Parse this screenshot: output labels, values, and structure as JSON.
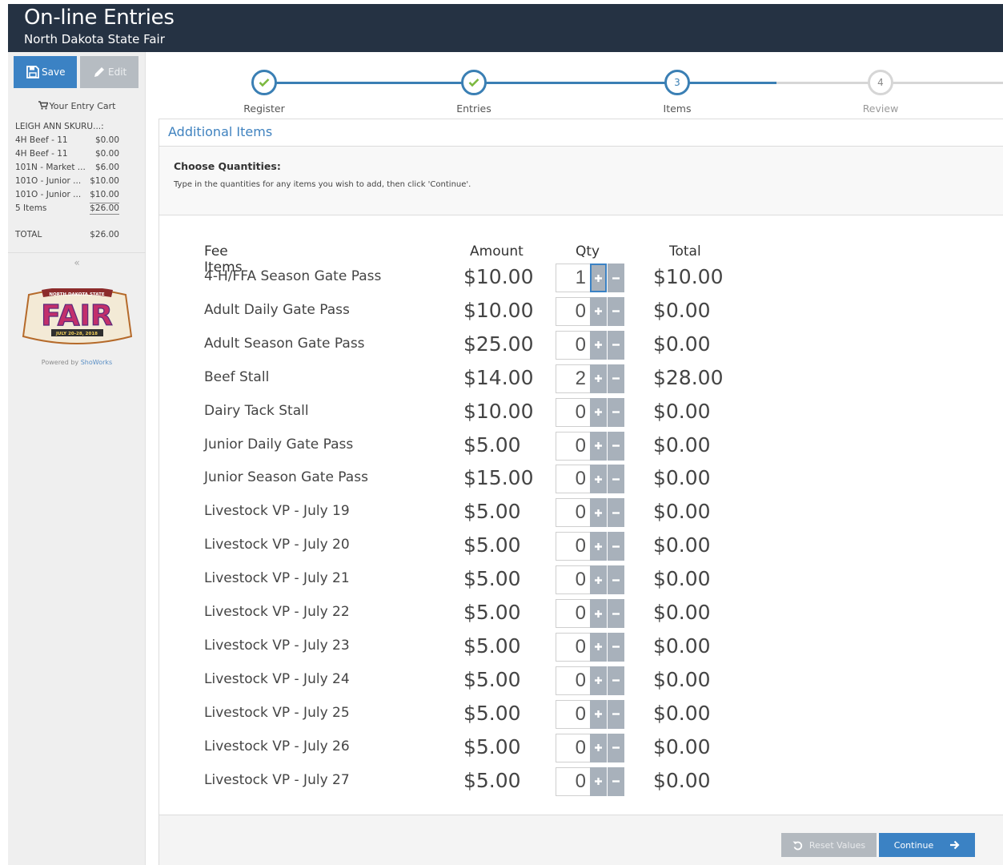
{
  "header": {
    "title": "On-line Entries",
    "subtitle": "North Dakota State Fair"
  },
  "sidebar": {
    "save_label": "Save",
    "edit_label": "Edit",
    "cart_title": "Your Entry Cart",
    "cart_owner": "LEIGH ANN SKURU...:",
    "cart_items": [
      {
        "name": "4H Beef - 11",
        "amount": "$0.00"
      },
      {
        "name": "4H Beef - 11",
        "amount": "$0.00"
      },
      {
        "name": "101N - Market ...",
        "amount": "$6.00"
      },
      {
        "name": "101O - Junior ...",
        "amount": "$10.00"
      },
      {
        "name": "101O - Junior ...",
        "amount": "$10.00"
      }
    ],
    "items_count": "5 Items",
    "items_subtotal": "$26.00",
    "total_label": "TOTAL",
    "total_value": "$26.00",
    "collapse_glyph": "«",
    "logo": {
      "top_text": "NORTH DAKOTA STATE",
      "main_text": "FAIR",
      "date_text": "JULY 20-28, 2018"
    },
    "powered_prefix": "Powered by",
    "powered_link": "ShoWorks"
  },
  "stepper": {
    "steps": [
      {
        "label": "Register",
        "state": "done",
        "number": ""
      },
      {
        "label": "Entries",
        "state": "done",
        "number": ""
      },
      {
        "label": "Items",
        "state": "current",
        "number": "3"
      },
      {
        "label": "Review",
        "state": "todo",
        "number": "4"
      }
    ]
  },
  "panel": {
    "title": "Additional Items",
    "instructions_heading": "Choose Quantities:",
    "instructions_text": "Type in the quantities for any items you wish to add, then click 'Continue'."
  },
  "table": {
    "headers": {
      "fee_items": "Fee Items",
      "amount": "Amount",
      "qty": "Qty",
      "total": "Total"
    },
    "rows": [
      {
        "name": "4-H/FFA Season Gate Pass",
        "amount": "$10.00",
        "qty": "1",
        "total": "$10.00"
      },
      {
        "name": "Adult Daily Gate Pass",
        "amount": "$10.00",
        "qty": "0",
        "total": "$0.00"
      },
      {
        "name": "Adult Season Gate Pass",
        "amount": "$25.00",
        "qty": "0",
        "total": "$0.00"
      },
      {
        "name": "Beef Stall",
        "amount": "$14.00",
        "qty": "2",
        "total": "$28.00"
      },
      {
        "name": "Dairy Tack Stall",
        "amount": "$10.00",
        "qty": "0",
        "total": "$0.00"
      },
      {
        "name": "Junior Daily Gate Pass",
        "amount": "$5.00",
        "qty": "0",
        "total": "$0.00"
      },
      {
        "name": "Junior Season Gate Pass",
        "amount": "$15.00",
        "qty": "0",
        "total": "$0.00"
      },
      {
        "name": "Livestock VP - July 19",
        "amount": "$5.00",
        "qty": "0",
        "total": "$0.00"
      },
      {
        "name": "Livestock VP - July 20",
        "amount": "$5.00",
        "qty": "0",
        "total": "$0.00"
      },
      {
        "name": "Livestock VP - July 21",
        "amount": "$5.00",
        "qty": "0",
        "total": "$0.00"
      },
      {
        "name": "Livestock VP - July 22",
        "amount": "$5.00",
        "qty": "0",
        "total": "$0.00"
      },
      {
        "name": "Livestock VP - July 23",
        "amount": "$5.00",
        "qty": "0",
        "total": "$0.00"
      },
      {
        "name": "Livestock VP - July 24",
        "amount": "$5.00",
        "qty": "0",
        "total": "$0.00"
      },
      {
        "name": "Livestock VP - July 25",
        "amount": "$5.00",
        "qty": "0",
        "total": "$0.00"
      },
      {
        "name": "Livestock VP - July 26",
        "amount": "$5.00",
        "qty": "0",
        "total": "$0.00"
      },
      {
        "name": "Livestock VP - July 27",
        "amount": "$5.00",
        "qty": "0",
        "total": "$0.00"
      }
    ]
  },
  "footer": {
    "reset_label": "Reset Values",
    "continue_label": "Continue"
  },
  "colors": {
    "header_bg": "#253243",
    "accent": "#3b82c4",
    "step_line_done": "#3a7fb4",
    "step_line_todo": "#d6d6d6",
    "step_check": "#7cb93f",
    "stepper_button": "#a8b1bb"
  },
  "icons": {
    "save": "floppy-disk-icon",
    "edit": "pencil-icon",
    "cart": "shopping-cart-icon",
    "step_done": "check-icon",
    "plus": "plus-icon",
    "minus": "minus-icon",
    "reset": "undo-icon",
    "continue": "arrow-right-icon"
  }
}
